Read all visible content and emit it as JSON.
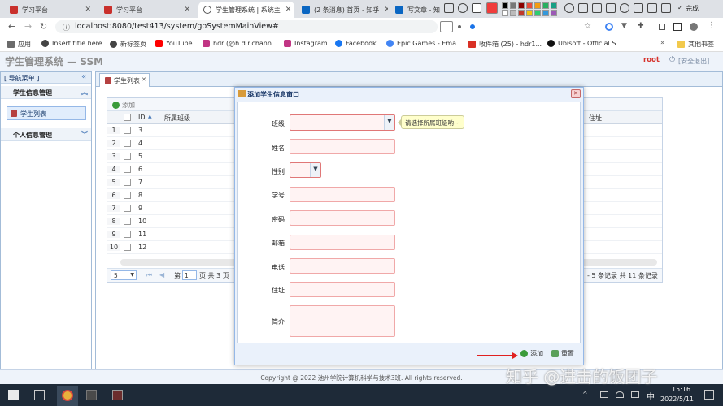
{
  "browser": {
    "tabs": [
      {
        "title": "学习平台",
        "favicon_color": "#c9302c"
      },
      {
        "title": "学习平台",
        "favicon_color": "#c9302c"
      },
      {
        "title": "学生管理系统 | 系统主",
        "favicon_color": "#555555"
      },
      {
        "title": "(2 条消息) 首页 - 知乎",
        "favicon_color": "#0a66c2"
      },
      {
        "title": "写文章 - 知",
        "favicon_color": "#0a66c2"
      }
    ],
    "finish_label": "完成",
    "url": "localhost:8080/test413/system/goSystemMainView#",
    "bookmarks": [
      {
        "label": "应用",
        "color": "#6b6b6b"
      },
      {
        "label": "Insert title here",
        "color": "#444444"
      },
      {
        "label": "新标签页",
        "color": "#444444"
      },
      {
        "label": "YouTube",
        "color": "#ff0000"
      },
      {
        "label": "hdr (@h.d.r.chann...",
        "color": "#c13584"
      },
      {
        "label": "Instagram",
        "color": "#c13584"
      },
      {
        "label": "Facebook",
        "color": "#1877f2"
      },
      {
        "label": "Epic Games - Ema...",
        "color": "#4285f4"
      },
      {
        "label": "收件箱 (25) - hdr1...",
        "color": "#d93025"
      },
      {
        "label": "Ubisoft - Official S...",
        "color": "#111111"
      }
    ],
    "other_bookmarks": "其他书签"
  },
  "app": {
    "title": "学生管理系统 — SSM",
    "user": "root",
    "logout": "[安全退出]"
  },
  "nav": {
    "header": "[ 导航菜单 ]",
    "section1": "学生信息管理",
    "link": "学生列表",
    "section2": "个人信息管理"
  },
  "center": {
    "tab_label": "学生列表",
    "add_button": "添加",
    "columns": {
      "id": "ID",
      "class": "所属班级",
      "address": "住址"
    },
    "rows": [
      {
        "n": "1",
        "id": "3"
      },
      {
        "n": "2",
        "id": "4"
      },
      {
        "n": "3",
        "id": "5"
      },
      {
        "n": "4",
        "id": "6"
      },
      {
        "n": "5",
        "id": "7"
      },
      {
        "n": "6",
        "id": "8"
      },
      {
        "n": "7",
        "id": "9"
      },
      {
        "n": "8",
        "id": "10"
      },
      {
        "n": "9",
        "id": "11"
      },
      {
        "n": "10",
        "id": "12"
      }
    ],
    "pager": {
      "page_size": "5",
      "page_prefix": "第",
      "page": "1",
      "page_suffix": "页 共 3 页",
      "summary": "- 5 条记录 共 11 条记录"
    }
  },
  "dialog": {
    "title": "添加学生信息窗口",
    "fields": {
      "class": "班级",
      "name": "姓名",
      "gender": "性别",
      "student_no": "学号",
      "password": "密码",
      "email": "邮箱",
      "phone": "电话",
      "address": "住址",
      "intro": "简介"
    },
    "tooltip": "请选择所属班级哟~",
    "add_button": "添加",
    "reset_button": "重置"
  },
  "footer": "Copyright @ 2022 池州学院计算机科学与技术3班. All rights reserved.",
  "watermark": "知乎 @进击的饭团子",
  "taskbar": {
    "time": "15:16",
    "date": "2022/5/11",
    "ime": "中"
  }
}
